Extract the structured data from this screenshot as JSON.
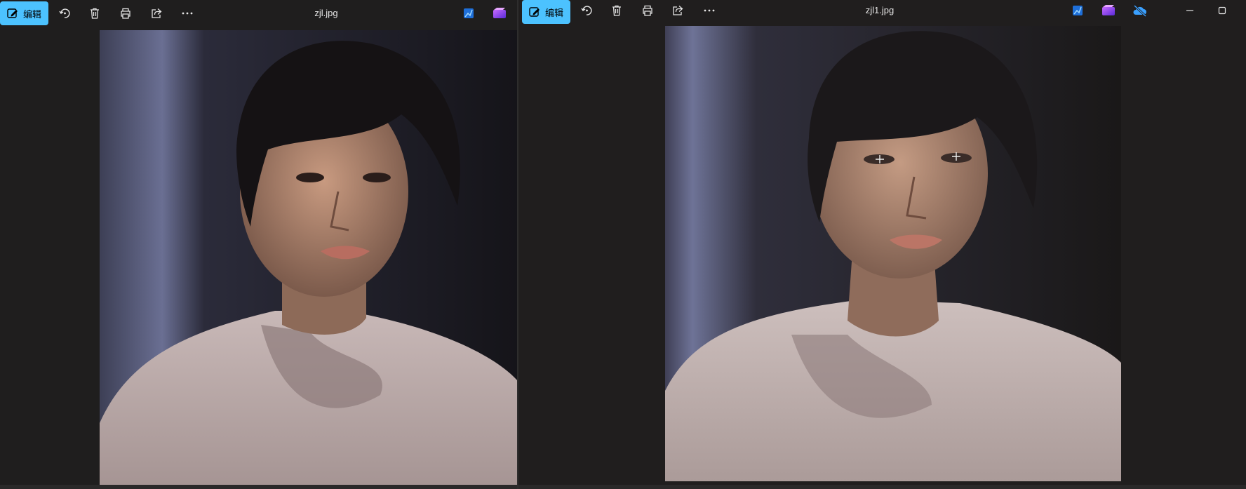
{
  "left_window": {
    "edit_label": "编辑",
    "filename": "zjl.jpg",
    "toolbar_icons": [
      "edit-icon",
      "rotate-icon",
      "delete-icon",
      "print-icon",
      "share-icon",
      "more-icon"
    ],
    "right_icons": [
      "photo-edit-icon",
      "clipchamp-icon"
    ]
  },
  "right_window": {
    "edit_label": "编辑",
    "filename": "zjl1.jpg",
    "toolbar_icons": [
      "edit-icon",
      "rotate-icon",
      "delete-icon",
      "print-icon",
      "share-icon",
      "more-icon"
    ],
    "right_icons": [
      "photo-edit-icon",
      "clipchamp-icon",
      "cloud-off-icon"
    ],
    "window_controls": [
      "minimize-icon",
      "maximize-icon"
    ]
  },
  "colors": {
    "accent": "#4cc2ff",
    "background": "#1f1e1e",
    "cloud_icon": "#3aa0ff"
  }
}
